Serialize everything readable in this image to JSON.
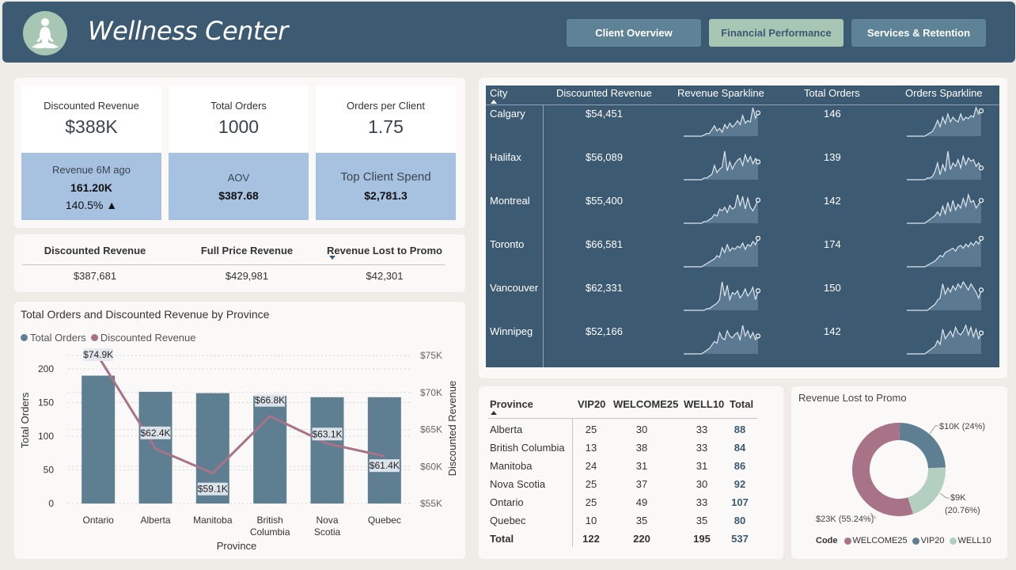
{
  "header": {
    "title": "Wellness Center",
    "nav": [
      {
        "label": "Client Overview",
        "active": false
      },
      {
        "label": "Financial Performance",
        "active": true
      },
      {
        "label": "Services & Retention",
        "active": false
      }
    ]
  },
  "kpis": [
    {
      "label": "Discounted Revenue",
      "value": "$388K",
      "sub_label": "Revenue 6M ago",
      "sub_value": "161.20K",
      "sub_extra": "140.5% ▲"
    },
    {
      "label": "Total Orders",
      "value": "1000",
      "sub_label": "AOV",
      "sub_value": "$387.68"
    },
    {
      "label": "Orders per Client",
      "value": "1.75",
      "sub_label": "Top Client Spend",
      "sub_value": "$2,781.3"
    }
  ],
  "revenue_summary": {
    "headers": [
      "Discounted Revenue",
      "Full Price Revenue",
      "Revenue Lost to Promo"
    ],
    "values": [
      "$387,681",
      "$429,981",
      "$42,301"
    ]
  },
  "province_chart": {
    "title": "Total Orders and Discounted Revenue by Province",
    "legend": [
      "Total Orders",
      "Discounted Revenue"
    ],
    "y_left_label": "Total Orders",
    "y_right_label": "Discounted Revenue",
    "x_label": "Province",
    "y_left_ticks": [
      "0",
      "50",
      "100",
      "150",
      "200"
    ],
    "y_right_ticks": [
      "$55K",
      "$60K",
      "$65K",
      "$70K",
      "$75K"
    ]
  },
  "chart_data": {
    "type": "bar",
    "title": "Total Orders and Discounted Revenue by Province",
    "categories": [
      "Ontario",
      "Alberta",
      "Manitoba",
      "British Columbia",
      "Nova Scotia",
      "Quebec"
    ],
    "series": [
      {
        "name": "Total Orders",
        "type": "bar",
        "axis": "left",
        "values": [
          190,
          166,
          164,
          160,
          158,
          158
        ],
        "color": "#5e7f91"
      },
      {
        "name": "Discounted Revenue",
        "type": "line",
        "axis": "right",
        "values": [
          74900,
          62400,
          59100,
          66800,
          63100,
          61400
        ],
        "labels": [
          "$74.9K",
          "$62.4K",
          "$59.1K",
          "$66.8K",
          "$63.1K",
          "$61.4K"
        ],
        "color": "#a87387"
      }
    ],
    "ylim_left": [
      0,
      225
    ],
    "ylim_right": [
      55000,
      77000
    ],
    "xlabel": "Province",
    "ylabel": "Total Orders",
    "ylabel_right": "Discounted Revenue",
    "legend": "top-left",
    "grid": true
  },
  "city_table": {
    "headers": [
      "City",
      "Discounted Revenue",
      "Revenue Sparkline",
      "Total Orders",
      "Orders Sparkline"
    ],
    "rows": [
      {
        "city": "Calgary",
        "revenue": "$54,451",
        "orders": "146"
      },
      {
        "city": "Halifax",
        "revenue": "$56,089",
        "orders": "139"
      },
      {
        "city": "Montreal",
        "revenue": "$55,400",
        "orders": "142"
      },
      {
        "city": "Toronto",
        "revenue": "$66,581",
        "orders": "174"
      },
      {
        "city": "Vancouver",
        "revenue": "$62,331",
        "orders": "150"
      },
      {
        "city": "Winnipeg",
        "revenue": "$52,166",
        "orders": "142"
      }
    ]
  },
  "promo_table": {
    "headers": [
      "Province",
      "VIP20",
      "WELCOME25",
      "WELL10",
      "Total"
    ],
    "rows": [
      [
        "Alberta",
        "25",
        "30",
        "33",
        "88"
      ],
      [
        "British Columbia",
        "13",
        "38",
        "33",
        "84"
      ],
      [
        "Manitoba",
        "24",
        "31",
        "31",
        "86"
      ],
      [
        "Nova Scotia",
        "25",
        "37",
        "30",
        "92"
      ],
      [
        "Ontario",
        "25",
        "49",
        "33",
        "107"
      ],
      [
        "Quebec",
        "10",
        "35",
        "35",
        "80"
      ]
    ],
    "total": [
      "Total",
      "122",
      "220",
      "195",
      "537"
    ]
  },
  "promo_donut": {
    "title": "Revenue Lost to Promo",
    "legend_title": "Code",
    "slices": [
      {
        "name": "WELCOME25",
        "label": "$23K (55.24%)",
        "fraction": 0.5524,
        "color": "#a87387"
      },
      {
        "name": "VIP20",
        "label": "$10K (24%)",
        "fraction": 0.24,
        "color": "#5e7f91"
      },
      {
        "name": "WELL10",
        "label_line1": "$9K",
        "label_line2": "(20.76%)",
        "fraction": 0.2076,
        "color": "#b3cfbf"
      }
    ]
  }
}
